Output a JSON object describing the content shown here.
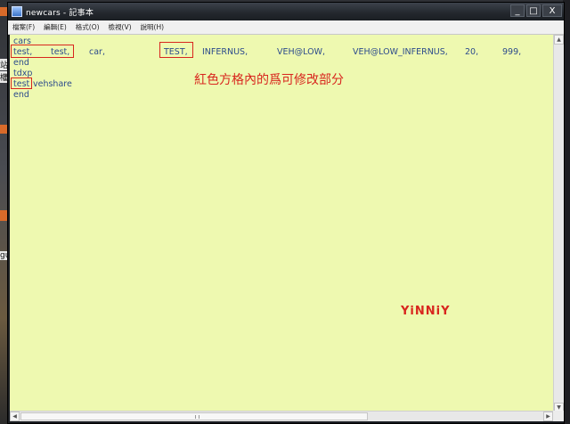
{
  "window": {
    "title": "newcars - 記事本",
    "controls": {
      "minimize": "_",
      "maximize": "□",
      "close": "X"
    }
  },
  "menu": [
    "檔案(F)",
    "編輯(E)",
    "格式(O)",
    "檢視(V)",
    "說明(H)"
  ],
  "editor": {
    "lines": [
      "cars",
      "end",
      "tdxp",
      "end"
    ],
    "row2_tokens": [
      "test,",
      "test,",
      "car,",
      "TEST,",
      "INFERNUS,",
      "VEH@LOW,",
      "VEH@LOW_INFERNUS,",
      "20,",
      "999,"
    ],
    "row6_tokens": [
      "test",
      "vehshare"
    ]
  },
  "annotation": {
    "note": "紅色方格內的爲可修改部分",
    "watermark": "YiNNiY"
  },
  "desktop": {
    "side_text_1": "站",
    "side_text_2": "權",
    "side_text_3": "gu"
  },
  "colors": {
    "editor_bg": "#eef9b0",
    "text": "#2c4b8c",
    "highlight_red": "#d8261e"
  }
}
